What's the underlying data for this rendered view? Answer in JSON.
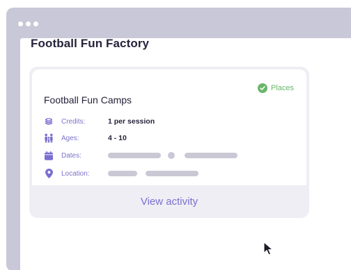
{
  "page": {
    "title": "Football Fun Factory"
  },
  "card": {
    "title": "Football Fun Camps",
    "status": "Places",
    "rows": [
      {
        "label": "Credits:",
        "value": "1 per session",
        "icon": "coins-icon"
      },
      {
        "label": "Ages:",
        "value": "4 - 10",
        "icon": "family-icon"
      },
      {
        "label": "Dates:",
        "value": "",
        "icon": "calendar-icon"
      },
      {
        "label": "Location:",
        "value": "",
        "icon": "location-pin-icon"
      }
    ],
    "action_label": "View activity"
  },
  "colors": {
    "accent": "#7a6fd0",
    "status_green": "#6bb66a",
    "window_chrome": "#c9c8d8",
    "text_dark": "#25233a",
    "placeholder": "#c9c8d4"
  }
}
